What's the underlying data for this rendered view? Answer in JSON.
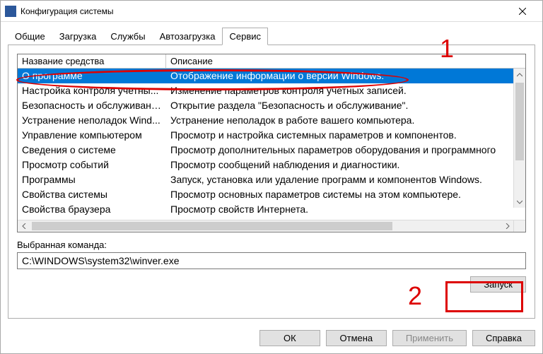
{
  "window": {
    "title": "Конфигурация системы"
  },
  "tabs": {
    "general": "Общие",
    "boot": "Загрузка",
    "services": "Службы",
    "startup": "Автозагрузка",
    "tools": "Сервис"
  },
  "columns": {
    "tool": "Название средства",
    "desc": "Описание"
  },
  "rows": [
    {
      "tool": "О программе",
      "desc": "Отображение информации о версии Windows."
    },
    {
      "tool": "Настройка контроля учетны...",
      "desc": "Изменение параметров контроля учетных записей."
    },
    {
      "tool": "Безопасность и обслуживание",
      "desc": "Открытие раздела \"Безопасность и обслуживание\"."
    },
    {
      "tool": "Устранение неполадок Wind...",
      "desc": "Устранение неполадок в работе вашего компьютера."
    },
    {
      "tool": "Управление компьютером",
      "desc": "Просмотр и настройка системных параметров и компонентов."
    },
    {
      "tool": "Сведения о системе",
      "desc": "Просмотр дополнительных параметров оборудования и программного"
    },
    {
      "tool": "Просмотр событий",
      "desc": "Просмотр сообщений наблюдения и диагностики."
    },
    {
      "tool": "Программы",
      "desc": "Запуск, установка или удаление программ и компонентов Windows."
    },
    {
      "tool": "Свойства системы",
      "desc": "Просмотр основных параметров системы на этом компьютере."
    },
    {
      "tool": "Свойства браузера",
      "desc": "Просмотр свойств Интернета."
    }
  ],
  "selected_label": "Выбранная команда:",
  "selected_value": "C:\\WINDOWS\\system32\\winver.exe",
  "buttons": {
    "launch": "Запуск",
    "ok": "ОК",
    "cancel": "Отмена",
    "apply": "Применить",
    "help": "Справка"
  },
  "annotations": {
    "n1": "1",
    "n2": "2"
  }
}
